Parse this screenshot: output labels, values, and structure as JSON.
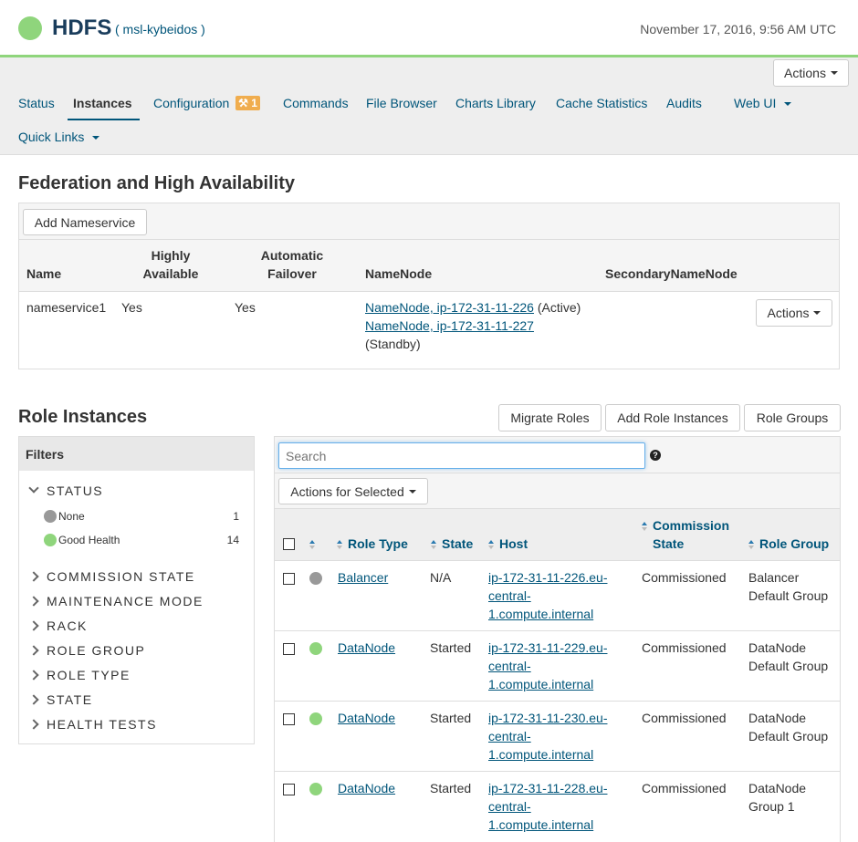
{
  "header": {
    "service": "HDFS",
    "cluster": "( msl-kybeidos )",
    "datetime": "November 17, 2016, 9:56 AM UTC",
    "status_color": "#8fd57c"
  },
  "toolbar": {
    "actions_label": "Actions"
  },
  "tabs": [
    {
      "label": "Status"
    },
    {
      "label": "Instances"
    },
    {
      "label": "Configuration",
      "badge": "1"
    },
    {
      "label": "Commands"
    },
    {
      "label": "File Browser"
    },
    {
      "label": "Charts Library"
    },
    {
      "label": "Cache Statistics"
    },
    {
      "label": "Audits"
    },
    {
      "label": "Web UI"
    },
    {
      "label": "Quick Links"
    }
  ],
  "federation": {
    "title": "Federation and High Availability",
    "add_button": "Add Nameservice",
    "columns": {
      "name": "Name",
      "highly_available_1": "Highly",
      "highly_available_2": "Available",
      "auto_failover_1": "Automatic",
      "auto_failover_2": "Failover",
      "namenode": "NameNode",
      "secondary": "SecondaryNameNode"
    },
    "row": {
      "name": "nameservice1",
      "highly_available": "Yes",
      "auto_failover": "Yes",
      "namenode_1_link": "NameNode, ip-172-31-11-226",
      "namenode_1_state": "(Active)",
      "namenode_2_link": "NameNode, ip-172-31-11-227",
      "namenode_2_state": "(Standby)",
      "actions_label": "Actions"
    }
  },
  "role_instances": {
    "title": "Role Instances",
    "buttons": {
      "migrate": "Migrate Roles",
      "add": "Add Role Instances",
      "groups": "Role Groups"
    },
    "search_placeholder": "Search",
    "actions_selected": "Actions for Selected",
    "columns": {
      "role_type": "Role Type",
      "state": "State",
      "host": "Host",
      "commission_1": "Commission",
      "commission_2": "State",
      "role_group": "Role Group"
    },
    "rows": [
      {
        "health": "none",
        "role_type": "Balancer",
        "state": "N/A",
        "host": [
          "ip-172-31-11-226.eu-",
          "central-",
          "1.compute.internal"
        ],
        "commission": "Commissioned",
        "group": [
          "Balancer",
          "Default Group"
        ]
      },
      {
        "health": "good",
        "role_type": "DataNode",
        "state": "Started",
        "host": [
          "ip-172-31-11-229.eu-",
          "central-",
          "1.compute.internal"
        ],
        "commission": "Commissioned",
        "group": [
          "DataNode",
          "Default Group"
        ]
      },
      {
        "health": "good",
        "role_type": "DataNode",
        "state": "Started",
        "host": [
          "ip-172-31-11-230.eu-",
          "central-",
          "1.compute.internal"
        ],
        "commission": "Commissioned",
        "group": [
          "DataNode",
          "Default Group"
        ]
      },
      {
        "health": "good",
        "role_type": "DataNode",
        "state": "Started",
        "host": [
          "ip-172-31-11-228.eu-",
          "central-",
          "1.compute.internal"
        ],
        "commission": "Commissioned",
        "group": [
          "DataNode",
          "Group 1"
        ]
      }
    ]
  },
  "filters": {
    "title": "Filters",
    "status_label": "STATUS",
    "status_items": [
      {
        "label": "None",
        "count": "1",
        "color": "#999999"
      },
      {
        "label": "Good Health",
        "count": "14",
        "color": "#8fd57c"
      }
    ],
    "categories": [
      "COMMISSION STATE",
      "MAINTENANCE MODE",
      "RACK",
      "ROLE GROUP",
      "ROLE TYPE",
      "STATE",
      "HEALTH TESTS"
    ]
  }
}
